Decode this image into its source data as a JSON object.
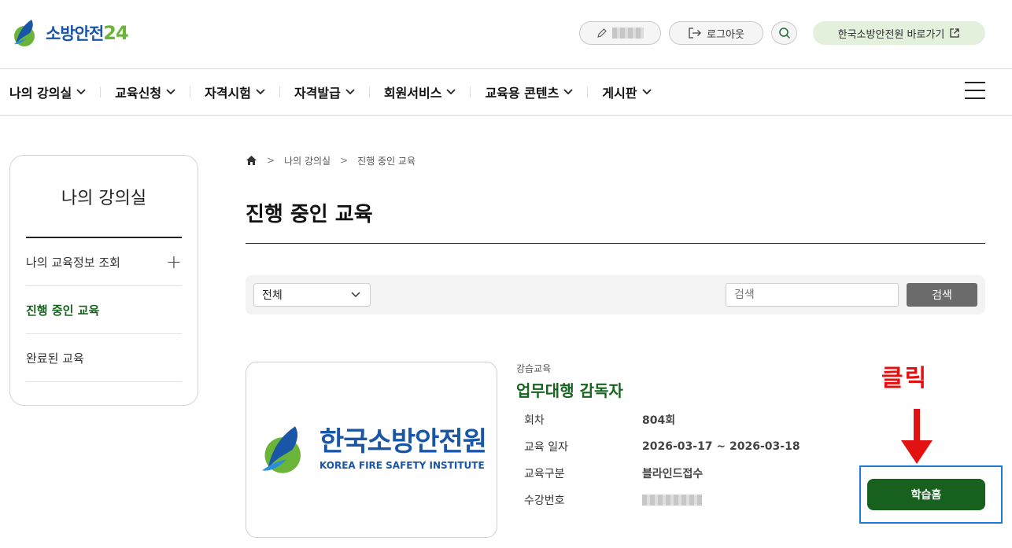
{
  "header": {
    "logo_text": "소방안전",
    "logo_num": "24",
    "logout_label": "로그아웃",
    "kfsi_link_label": "한국소방안전원 바로가기"
  },
  "nav": {
    "items": [
      {
        "label": "나의 강의실"
      },
      {
        "label": "교육신청"
      },
      {
        "label": "자격시험"
      },
      {
        "label": "자격발급"
      },
      {
        "label": "회원서비스"
      },
      {
        "label": "교육용 콘텐츠"
      },
      {
        "label": "게시판"
      }
    ]
  },
  "sidebar": {
    "title": "나의 강의실",
    "items": [
      {
        "label": "나의 교육정보 조회",
        "expand": "+"
      },
      {
        "label": "진행 중인 교육"
      },
      {
        "label": "완료된 교육"
      }
    ]
  },
  "breadcrumb": {
    "items": [
      "나의 강의실",
      "진행 중인 교육"
    ],
    "separator": ">"
  },
  "page": {
    "title": "진행 중인 교육"
  },
  "filter": {
    "select_value": "전체",
    "search_placeholder": "검색",
    "search_button": "검색"
  },
  "course": {
    "thumb_kor": "한국소방안전원",
    "thumb_eng": "KOREA FIRE SAFETY INSTITUTE",
    "category": "강습교육",
    "name": "업무대행 감독자",
    "rows": [
      {
        "label": "회차",
        "value": "804회"
      },
      {
        "label": "교육 일자",
        "value": "2026-03-17 ~ 2026-03-18"
      },
      {
        "label": "교육구분",
        "value": "블라인드접수"
      },
      {
        "label": "수강번호",
        "value": ""
      }
    ],
    "study_button": "학습홈"
  },
  "annotation": {
    "label": "클릭",
    "color": "#e31212",
    "highlight_color": "#1d7bd8"
  },
  "colors": {
    "brand_blue": "#1a56a8",
    "brand_green": "#6bb43a",
    "active_green": "#16641f",
    "button_green": "#17601e"
  }
}
